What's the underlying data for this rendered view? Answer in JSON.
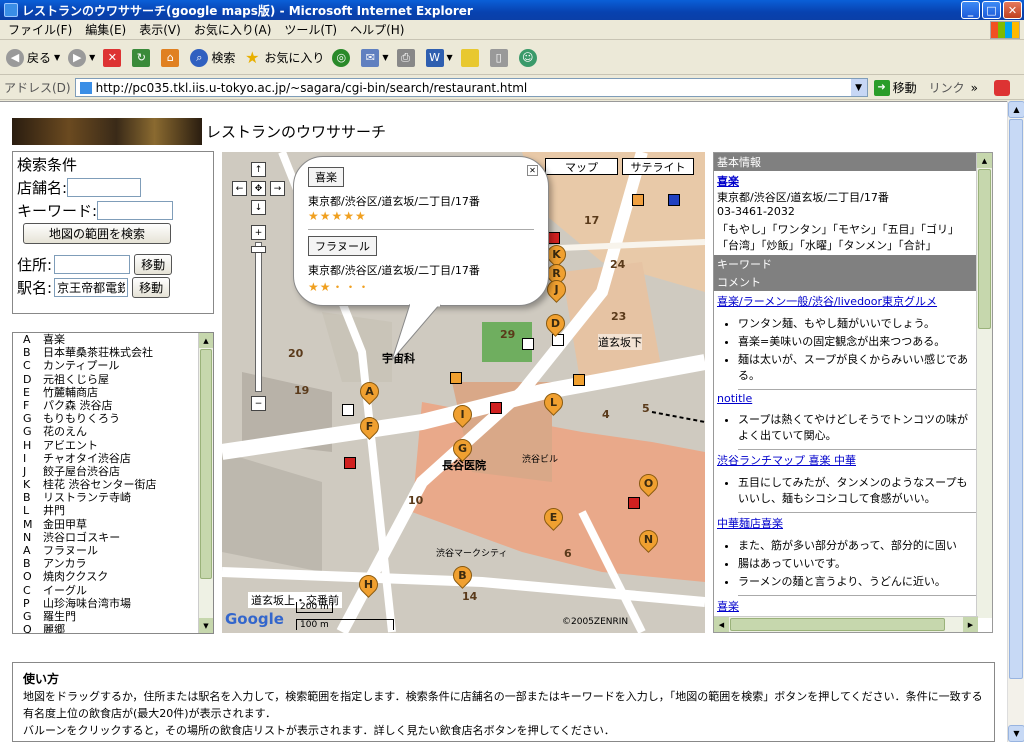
{
  "window": {
    "title": "レストランのウワササーチ(google maps版) - Microsoft Internet Explorer"
  },
  "menu": [
    "ファイル(F)",
    "編集(E)",
    "表示(V)",
    "お気に入り(A)",
    "ツール(T)",
    "ヘルプ(H)"
  ],
  "toolbar": {
    "back": "戻る",
    "search": "検索",
    "favorites": "お気に入り"
  },
  "address": {
    "label": "アドレス(D)",
    "url": "http://pc035.tkl.iis.u-tokyo.ac.jp/~sagara/cgi-bin/search/restaurant.html",
    "go": "移動",
    "links": "リンク"
  },
  "header": {
    "title": "レストランのウワササーチ"
  },
  "search": {
    "heading": "検索条件",
    "shop_label": "店舗名:",
    "keyword_label": "キーワード:",
    "map_search_btn": "地図の範囲を検索",
    "address_label": "住所:",
    "station_label": "駅名:",
    "station_value": "京王帝都電鉄",
    "move_btn": "移動"
  },
  "restaurants": [
    {
      "letter": "A",
      "name": "喜楽"
    },
    {
      "letter": "B",
      "name": "日本華桑茶荘株式会社"
    },
    {
      "letter": "C",
      "name": "カンティプール"
    },
    {
      "letter": "D",
      "name": "元祖くじら屋"
    },
    {
      "letter": "E",
      "name": "竹麓輔商店"
    },
    {
      "letter": "F",
      "name": "パク森 渋谷店"
    },
    {
      "letter": "G",
      "name": "もりもりくろう"
    },
    {
      "letter": "G",
      "name": "花のえん"
    },
    {
      "letter": "H",
      "name": "アビエント"
    },
    {
      "letter": "I",
      "name": "チャオタイ渋谷店"
    },
    {
      "letter": "J",
      "name": "餃子屋台渋谷店"
    },
    {
      "letter": "K",
      "name": "桂花 渋谷センター街店"
    },
    {
      "letter": "B",
      "name": "リストランテ寺崎"
    },
    {
      "letter": "L",
      "name": "井門"
    },
    {
      "letter": "M",
      "name": "金田甲草"
    },
    {
      "letter": "N",
      "name": "渋谷ロゴスキー"
    },
    {
      "letter": "A",
      "name": "フラヌール"
    },
    {
      "letter": "B",
      "name": "アンカラ"
    },
    {
      "letter": "O",
      "name": "焼肉ククスク"
    },
    {
      "letter": "C",
      "name": "イーグル"
    },
    {
      "letter": "P",
      "name": "山珍海味台湾市場"
    },
    {
      "letter": "G",
      "name": "羅生門"
    },
    {
      "letter": "Q",
      "name": "麗郷"
    }
  ],
  "map": {
    "type_map": "マップ",
    "type_satellite": "サテライト",
    "label_station": "道玄坂上・交番前",
    "scale_m": "200 m",
    "scale_100": "100 m",
    "copyright": "©2005ZENRIN",
    "google": "Google",
    "labels": [
      "道玄坂下",
      "宇宙科",
      "長谷医院",
      "渋谷マークシティ",
      "渋谷ビル"
    ],
    "blocks": [
      "19",
      "20",
      "24",
      "29",
      "10",
      "6",
      "4",
      "5",
      "23",
      "14",
      "17"
    ],
    "markers": [
      "K",
      "R",
      "J",
      "D",
      "A",
      "F",
      "I",
      "G",
      "L",
      "E",
      "O",
      "N",
      "H",
      "B"
    ],
    "balloon": {
      "name1": "喜楽",
      "addr1": "東京都/渋谷区/道玄坂/二丁目/17番",
      "stars1": "★★★★★",
      "name2": "フラヌール",
      "addr2": "東京都/渋谷区/道玄坂/二丁目/17番",
      "stars2": "★★・・・"
    }
  },
  "info": {
    "basic_label": "基本情報",
    "name": "喜楽",
    "address": "東京都/渋谷区/道玄坂/二丁目/17番",
    "phone": "03-3461-2032",
    "tags": "「もやし」「ワンタン」「モヤシ」「五目」「ゴリ」「台湾」「炒飯」「水曜」「タンメン」「合計」",
    "keyword_label": "キーワード",
    "comment_label": "コメント",
    "reviews": [
      {
        "source": "喜楽/ラーメン一般/渋谷/livedoor東京グルメ",
        "points": [
          "ワンタン麺、もやし麺がいいでしょう。",
          "喜楽=美味いの固定観念が出来つつある。",
          "麺は太いが、スープが良くからみいい感じである。"
        ]
      },
      {
        "source": "notitle",
        "points": [
          "スープは熱くてやけどしそうでトンコツの味がよく出ていて関心。"
        ]
      },
      {
        "source": "渋谷ランチマップ 喜楽 中華",
        "points": [
          "五目にしてみたが、タンメンのようなスープもいいし、麺もシコシコして食感がいい。"
        ]
      },
      {
        "source": "中華麺店喜楽",
        "points": [
          "また、筋が多い部分があって、部分的に固い",
          "腸はあっていいです。",
          "ラーメンの麺と言うより、うどんに近い。"
        ]
      },
      {
        "source": "喜楽",
        "points": []
      }
    ]
  },
  "usage": {
    "heading": "使い方",
    "line1": "地図をドラッグするか，住所または駅名を入力して，検索範囲を指定します．検索条件に店舗名の一部またはキーワードを入力し，「地図の範囲を検索」ボタンを押してください．条件に一致する有名度上位の飲食店が(最大20件)が表示されます．",
    "line2": "バルーンをクリックすると，その場所の飲食店リストが表示されます．詳しく見たい飲食店名ボタンを押してください．"
  }
}
